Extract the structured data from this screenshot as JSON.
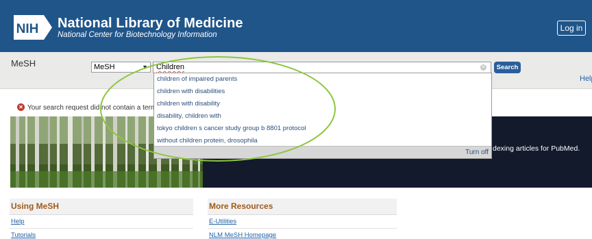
{
  "header": {
    "logo_text": "NIH",
    "title": "National Library of Medicine",
    "subtitle": "National Center for Biotechnology Information",
    "login_label": "Log in",
    "bg_color": "#20558a"
  },
  "search": {
    "db_label": "MeSH",
    "db_selected": "MeSH",
    "term_value": "Children",
    "search_label": "Search",
    "help_label": "Help"
  },
  "autocomplete": {
    "items": [
      "children of impaired parents",
      "children with disabilities",
      "children with disability",
      "disability, children with",
      "tokyo children s cancer study group b 8801 protocol",
      "without children protein, drosophila"
    ],
    "turn_off_label": "Turn off"
  },
  "warning": {
    "text": "Your search request did not contain a term."
  },
  "hero": {
    "text": "dexing articles for PubMed."
  },
  "using_mesh": {
    "title": "Using MeSH",
    "links": [
      "Help",
      "Tutorials"
    ]
  },
  "more_resources": {
    "title": "More Resources",
    "links": [
      "E-Utilities",
      "NLM MeSH Homepage"
    ]
  },
  "colors": {
    "accent": "#2a5e9b",
    "link": "#2060a7",
    "section_title": "#a05a1a",
    "annotation": "#8cc63f"
  },
  "icons": {
    "logo": "nih-logo",
    "clear": "clear-icon",
    "dropdown": "chevron-down-icon",
    "warning": "error-icon"
  }
}
